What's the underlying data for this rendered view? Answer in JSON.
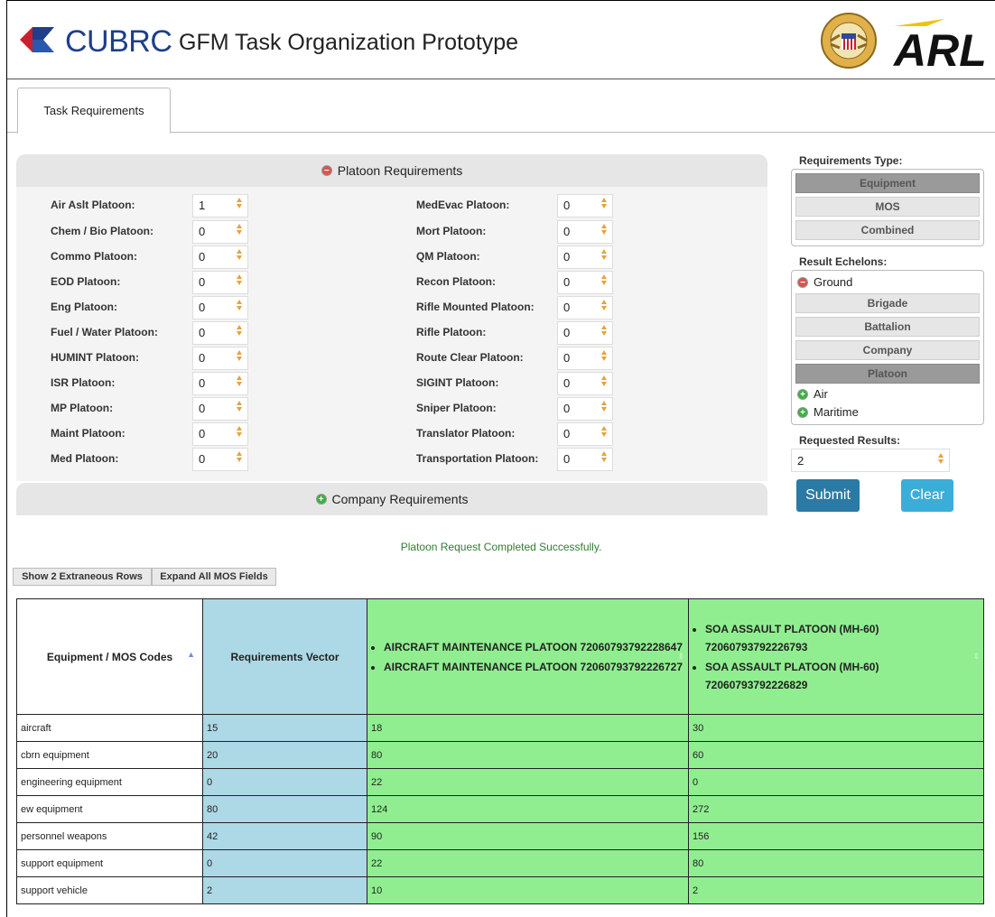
{
  "header": {
    "brand": "CUBRC",
    "title": "GFM Task Organization Prototype",
    "logo_text": "ARL"
  },
  "tabs": [
    {
      "label": "Task Requirements"
    }
  ],
  "platoon_panel": {
    "title": "Platoon Requirements",
    "left_fields": [
      {
        "label": "Air Aslt Platoon:",
        "value": "1"
      },
      {
        "label": "Chem / Bio Platoon:",
        "value": "0"
      },
      {
        "label": "Commo Platoon:",
        "value": "0"
      },
      {
        "label": "EOD Platoon:",
        "value": "0"
      },
      {
        "label": "Eng Platoon:",
        "value": "0"
      },
      {
        "label": "Fuel / Water Platoon:",
        "value": "0"
      },
      {
        "label": "HUMINT Platoon:",
        "value": "0"
      },
      {
        "label": "ISR Platoon:",
        "value": "0"
      },
      {
        "label": "MP Platoon:",
        "value": "0"
      },
      {
        "label": "Maint Platoon:",
        "value": "0"
      },
      {
        "label": "Med Platoon:",
        "value": "0"
      }
    ],
    "right_fields": [
      {
        "label": "MedEvac Platoon:",
        "value": "0"
      },
      {
        "label": "Mort Platoon:",
        "value": "0"
      },
      {
        "label": "QM Platoon:",
        "value": "0"
      },
      {
        "label": "Recon Platoon:",
        "value": "0"
      },
      {
        "label": "Rifle Mounted Platoon:",
        "value": "0"
      },
      {
        "label": "Rifle Platoon:",
        "value": "0"
      },
      {
        "label": "Route Clear Platoon:",
        "value": "0"
      },
      {
        "label": "SIGINT Platoon:",
        "value": "0"
      },
      {
        "label": "Sniper Platoon:",
        "value": "0"
      },
      {
        "label": "Translator Platoon:",
        "value": "0"
      },
      {
        "label": "Transportation Platoon:",
        "value": "0"
      }
    ]
  },
  "company_panel": {
    "title": "Company Requirements"
  },
  "sidebar": {
    "requirements_type_label": "Requirements Type:",
    "requirements_types": [
      "Equipment",
      "MOS",
      "Combined"
    ],
    "selected_requirements_type": "Equipment",
    "result_echelons_label": "Result Echelons:",
    "ground_label": "Ground",
    "ground_echelons": [
      "Brigade",
      "Battalion",
      "Company",
      "Platoon"
    ],
    "selected_echelon": "Platoon",
    "air_label": "Air",
    "maritime_label": "Maritime",
    "requested_results_label": "Requested Results:",
    "requested_results_value": "2",
    "submit_label": "Submit",
    "clear_label": "Clear"
  },
  "status_message": "Platoon Request Completed Successfully.",
  "actions": {
    "show_rows_label": "Show 2 Extraneous Rows",
    "expand_mos_label": "Expand All MOS Fields"
  },
  "results_table": {
    "col_codes": "Equipment / MOS Codes",
    "col_vector": "Requirements Vector",
    "result1": [
      "AIRCRAFT MAINTENANCE PLATOON 72060793792228647",
      "AIRCRAFT MAINTENANCE PLATOON 72060793792226727"
    ],
    "result2": [
      "SOA ASSAULT PLATOON (MH-60) 72060793792226793",
      "SOA ASSAULT PLATOON (MH-60) 72060793792226829"
    ],
    "rows": [
      {
        "code": "aircraft",
        "vector": "15",
        "r1": "18",
        "r2": "30"
      },
      {
        "code": "cbrn equipment",
        "vector": "20",
        "r1": "80",
        "r2": "60"
      },
      {
        "code": "engineering equipment",
        "vector": "0",
        "r1": "22",
        "r2": "0"
      },
      {
        "code": "ew equipment",
        "vector": "80",
        "r1": "124",
        "r2": "272"
      },
      {
        "code": "personnel weapons",
        "vector": "42",
        "r1": "90",
        "r2": "156"
      },
      {
        "code": "support equipment",
        "vector": "0",
        "r1": "22",
        "r2": "80"
      },
      {
        "code": "support vehicle",
        "vector": "2",
        "r1": "10",
        "r2": "2"
      }
    ]
  },
  "colors": {
    "vector_column": "#add8e6",
    "result_column": "#90ee90",
    "submit": "#2a7aa5",
    "clear": "#3aaed8",
    "spinner_arrows": "#e8a23d"
  }
}
